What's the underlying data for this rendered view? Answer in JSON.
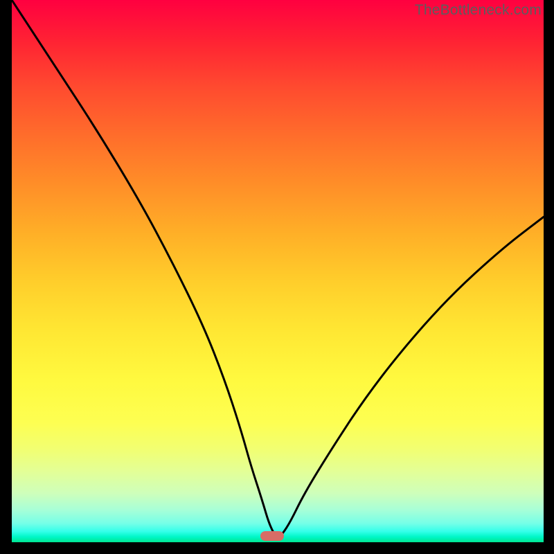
{
  "attribution": "TheBottleneck.com",
  "chart_data": {
    "type": "line",
    "title": "",
    "xlabel": "",
    "ylabel": "",
    "xlim": [
      0,
      100
    ],
    "ylim": [
      0,
      100
    ],
    "background_gradient": {
      "top": "#ff0040",
      "mid": "#fff93f",
      "bottom": "#00e692"
    },
    "series": [
      {
        "name": "bottleneck-curve",
        "x": [
          0,
          8,
          16,
          24,
          30,
          36,
          40,
          43,
          45,
          47,
          48.5,
          50,
          52,
          55,
          60,
          66,
          73,
          82,
          92,
          100
        ],
        "y": [
          100,
          88,
          76,
          63,
          52,
          40,
          30,
          21,
          14,
          8,
          3,
          0.5,
          3,
          9,
          17,
          26,
          35,
          45,
          54,
          60
        ]
      }
    ],
    "marker": {
      "name": "optimal-point",
      "x": 49,
      "y": 1.2,
      "color": "#d76d66"
    }
  }
}
